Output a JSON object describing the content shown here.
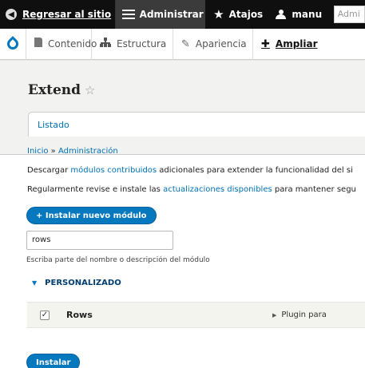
{
  "toolbar": {
    "back_label": "Regresar al sitio",
    "admin_label": "Administrar",
    "shortcuts_label": "Atajos",
    "user_label": "manu",
    "search_placeholder": "Admi"
  },
  "tray": {
    "items": [
      {
        "label": "Contenido",
        "icon": "file-icon"
      },
      {
        "label": "Estructura",
        "icon": "sitemap-icon"
      },
      {
        "label": "Apariencia",
        "icon": "brush-icon"
      },
      {
        "label": "Ampliar",
        "icon": "puzzle-icon"
      }
    ]
  },
  "page": {
    "title": "Extend",
    "tab_label": "Listado"
  },
  "breadcrumb": {
    "home": "Inicio",
    "separator": "»",
    "admin": "Administración"
  },
  "intro": {
    "line1_pre": "Descargar ",
    "line1_link": "módulos contribuidos",
    "line1_post": " adicionales para extender la funcionalidad del si",
    "line2_pre": "Regularmente revise e instale las ",
    "line2_link": "actualizaciones disponibles",
    "line2_post": " para mantener segu"
  },
  "install_new_button": "+ Instalar nuevo módulo",
  "filter": {
    "value": "rows",
    "description": "Escriba parte del nombre o descripción del módulo"
  },
  "package": {
    "name": "PERSONALIZADO",
    "modules": [
      {
        "name": "Rows",
        "checked": true,
        "description": "Plugin para"
      }
    ]
  },
  "install_button": "Instalar",
  "colors": {
    "accent": "#0678be",
    "link": "#0071b3",
    "toolbar": "#0f0f0f"
  }
}
